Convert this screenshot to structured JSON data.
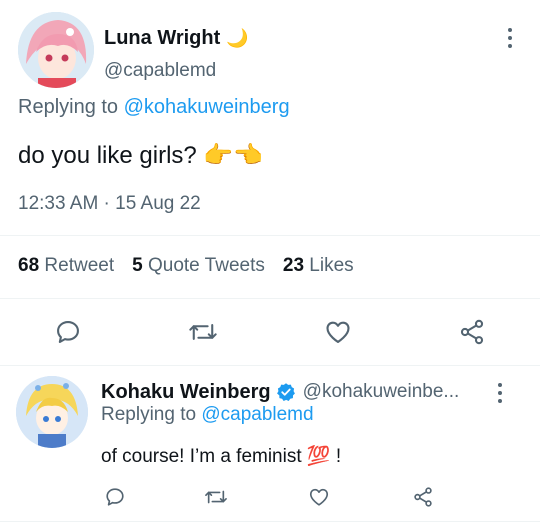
{
  "main_tweet": {
    "display_name": "Luna Wright",
    "name_emoji": "🌙",
    "handle": "@capablemd",
    "replying_prefix": "Replying to ",
    "replying_to": "@kohakuweinberg",
    "text": "do you like girls? 👉👈",
    "timestamp": "12:33 AM · 15 Aug 22",
    "stats": {
      "retweets_count": "68",
      "retweets_label": "Retweet",
      "quotes_count": "5",
      "quotes_label": "Quote Tweets",
      "likes_count": "23",
      "likes_label": "Likes"
    },
    "actions": [
      "reply-icon",
      "retweet-icon",
      "like-icon",
      "share-icon"
    ]
  },
  "reply_tweet": {
    "display_name": "Kohaku Weinberg",
    "verified": true,
    "handle": "@kohakuweinbe...",
    "replying_prefix": "Replying to ",
    "replying_to": "@capablemd",
    "text": "of course! I’m a feminist 💯 !",
    "actions": [
      "reply-icon",
      "retweet-icon",
      "like-icon",
      "share-icon"
    ]
  },
  "colors": {
    "link": "#1d9bf0",
    "secondary_text": "#536471",
    "icon": "#536471",
    "verified": "#1d9bf0"
  }
}
